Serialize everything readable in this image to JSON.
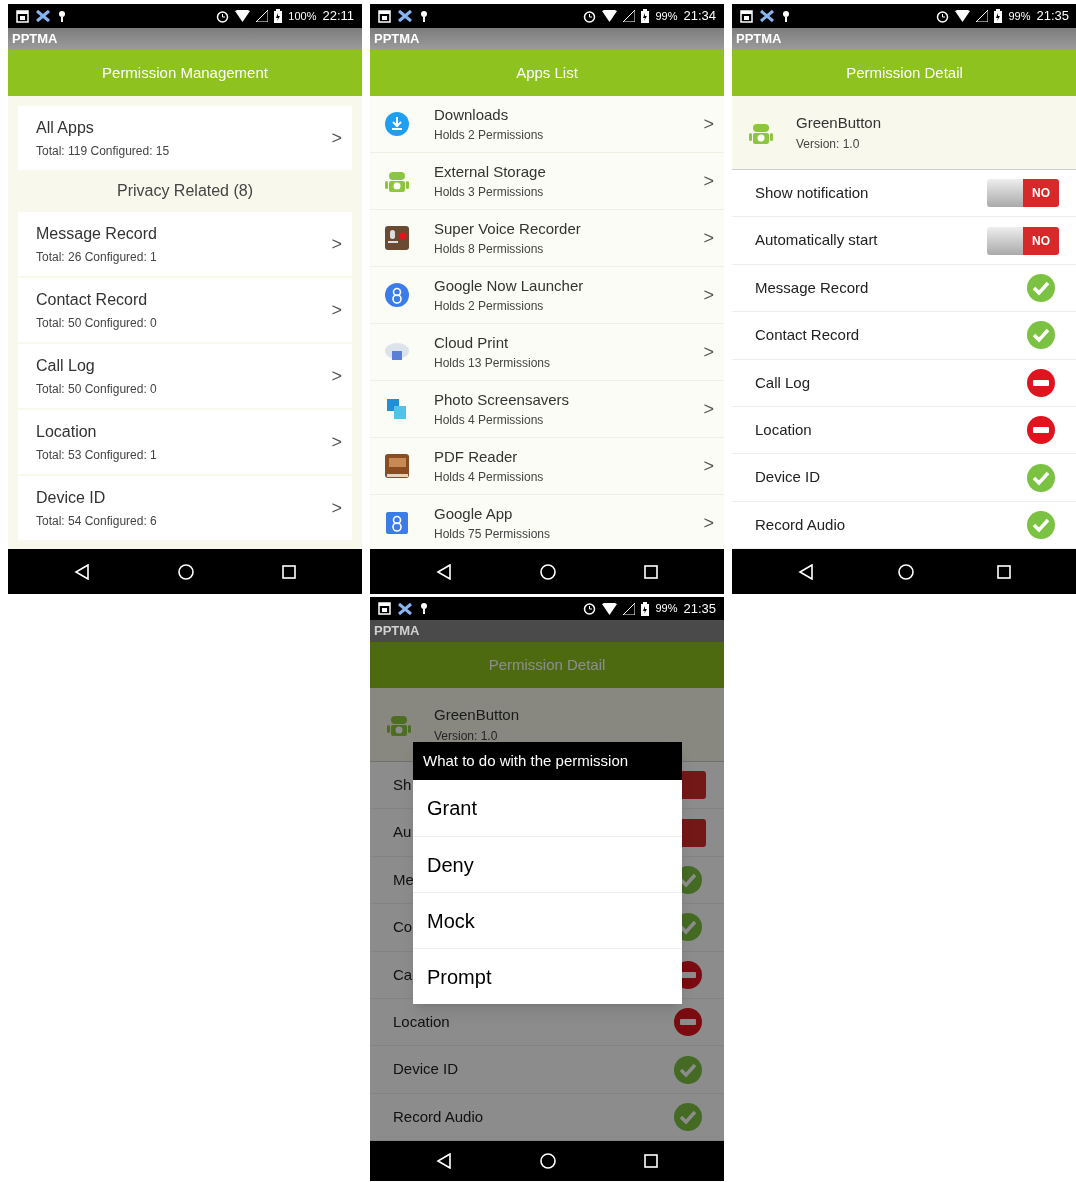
{
  "screens": [
    {
      "kind": "permission_management",
      "status_bar": {
        "battery": "100%",
        "time": "22:11"
      },
      "app_name": "PPTMA",
      "title": "Permission Management",
      "all_apps": {
        "name": "All Apps",
        "summary": "Total: 119  Configured: 15",
        "arrow": ">"
      },
      "section": "Privacy Related (8)",
      "items": [
        {
          "name": "Message Record",
          "summary": "Total: 26  Configured: 1",
          "arrow": ">"
        },
        {
          "name": "Contact Record",
          "summary": "Total: 50  Configured: 0",
          "arrow": ">"
        },
        {
          "name": "Call Log",
          "summary": "Total: 50  Configured: 0",
          "arrow": ">"
        },
        {
          "name": "Location",
          "summary": "Total: 53  Configured: 1",
          "arrow": ">"
        },
        {
          "name": "Device ID",
          "summary": "Total: 54  Configured: 6",
          "arrow": ">"
        }
      ]
    },
    {
      "kind": "apps_list",
      "status_bar": {
        "battery": "99%",
        "time": "21:34"
      },
      "app_name": "PPTMA",
      "title": "Apps List",
      "apps": [
        {
          "name": "Downloads",
          "summary": "Holds 2 Permissions",
          "arrow": ">"
        },
        {
          "name": "External Storage",
          "summary": "Holds 3 Permissions",
          "arrow": ">"
        },
        {
          "name": "Super Voice Recorder",
          "summary": "Holds 8 Permissions",
          "arrow": ">"
        },
        {
          "name": "Google Now Launcher",
          "summary": "Holds 2 Permissions",
          "arrow": ">"
        },
        {
          "name": "Cloud Print",
          "summary": "Holds 13 Permissions",
          "arrow": ">"
        },
        {
          "name": "Photo Screensavers",
          "summary": "Holds 4 Permissions",
          "arrow": ">"
        },
        {
          "name": "PDF Reader",
          "summary": "Holds 4 Permissions",
          "arrow": ">"
        },
        {
          "name": "Google App",
          "summary": "Holds 75 Permissions",
          "arrow": ">"
        }
      ]
    },
    {
      "kind": "permission_detail",
      "status_bar": {
        "battery": "99%",
        "time": "21:35"
      },
      "app_name": "PPTMA",
      "title": "Permission Detail",
      "app": {
        "name": "GreenButton",
        "version": "Version: 1.0"
      },
      "rows": [
        {
          "kind": "toggle",
          "label": "Show notification",
          "on": false,
          "value": "NO"
        },
        {
          "kind": "toggle",
          "label": "Automatically start",
          "on": false,
          "value": "NO"
        },
        {
          "kind": "status",
          "label": "Message Record",
          "granted": true
        },
        {
          "kind": "status",
          "label": "Contact Record",
          "granted": true
        },
        {
          "kind": "status",
          "label": "Call Log",
          "granted": false
        },
        {
          "kind": "status",
          "label": "Location",
          "granted": false
        },
        {
          "kind": "status",
          "label": "Device ID",
          "granted": true
        },
        {
          "kind": "status",
          "label": "Record Audio",
          "granted": true
        }
      ]
    },
    {
      "kind": "permission_detail",
      "status_bar": {
        "battery": "99%",
        "time": "21:35"
      },
      "app_name": "PPTMA",
      "title": "Permission Detail",
      "app": {
        "name": "GreenButton",
        "version": "Version: 1.0"
      },
      "rows": [
        {
          "kind": "toggle",
          "label": "Sh",
          "on": false
        },
        {
          "kind": "toggle",
          "label": "Au",
          "on": false
        },
        {
          "kind": "status",
          "label": "Me",
          "granted": true
        },
        {
          "kind": "status",
          "label": "Co",
          "granted": true
        },
        {
          "kind": "status",
          "label": "Ca",
          "granted": false
        },
        {
          "kind": "status",
          "label": "Location",
          "granted": false
        },
        {
          "kind": "status",
          "label": "Device ID",
          "granted": true
        },
        {
          "kind": "status",
          "label": "Record Audio",
          "granted": true
        }
      ],
      "dialog": {
        "title": "What to do with the permission",
        "options": [
          "Grant",
          "Deny",
          "Mock",
          "Prompt"
        ]
      }
    }
  ]
}
